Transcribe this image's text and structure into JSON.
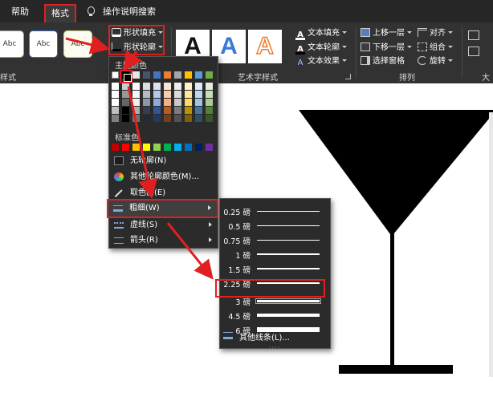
{
  "menubar": {
    "help": "帮助",
    "format": "格式",
    "search": "操作说明搜索"
  },
  "ribbon": {
    "shape_styles": {
      "label": "样式",
      "tiles": [
        "Abc",
        "Abc",
        "Abc"
      ]
    },
    "shape_fill": "形状填充",
    "shape_outline": "形状轮廓",
    "wordart": {
      "label": "艺术字样式",
      "tile_letter": "A",
      "text_fill": "文本填充",
      "text_outline": "文本轮廓",
      "text_effects": "文本效果"
    },
    "arrange": {
      "label": "排列",
      "bring_forward": "上移一层",
      "send_backward": "下移一层",
      "selection_pane": "选择窗格",
      "align": "对齐",
      "group": "组合",
      "rotate": "旋转"
    },
    "size_label": "大"
  },
  "color_dropdown": {
    "theme_colors": "主题颜色",
    "standard_colors": "标准色",
    "no_outline": "无轮廓(N)",
    "more_colors": "其他轮廓颜色(M)...",
    "eyedropper": "取色器(E)",
    "weight": "粗细(W)",
    "dashes": "虚线(S)",
    "arrows": "箭头(R)"
  },
  "weight_menu": {
    "items": [
      "0.25 磅",
      "0.5 磅",
      "0.75 磅",
      "1 磅",
      "1.5 磅",
      "2.25 磅",
      "3 磅",
      "4.5 磅",
      "6 磅"
    ],
    "more": "其他线条(L)..."
  },
  "colors": {
    "accent_red": "#e02020",
    "ribbon": "#323232",
    "menu_bg": "#2b2b2b",
    "theme_row": [
      "#ffffff",
      "#000000",
      "#e7e6e6",
      "#44546a",
      "#4472c4",
      "#ed7d31",
      "#a5a5a5",
      "#ffc000",
      "#5b9bd5",
      "#70ad47"
    ],
    "standard_row": [
      "#c00000",
      "#ff0000",
      "#ffc000",
      "#ffff00",
      "#92d050",
      "#00b050",
      "#00b0f0",
      "#0070c0",
      "#002060",
      "#7030a0"
    ]
  }
}
